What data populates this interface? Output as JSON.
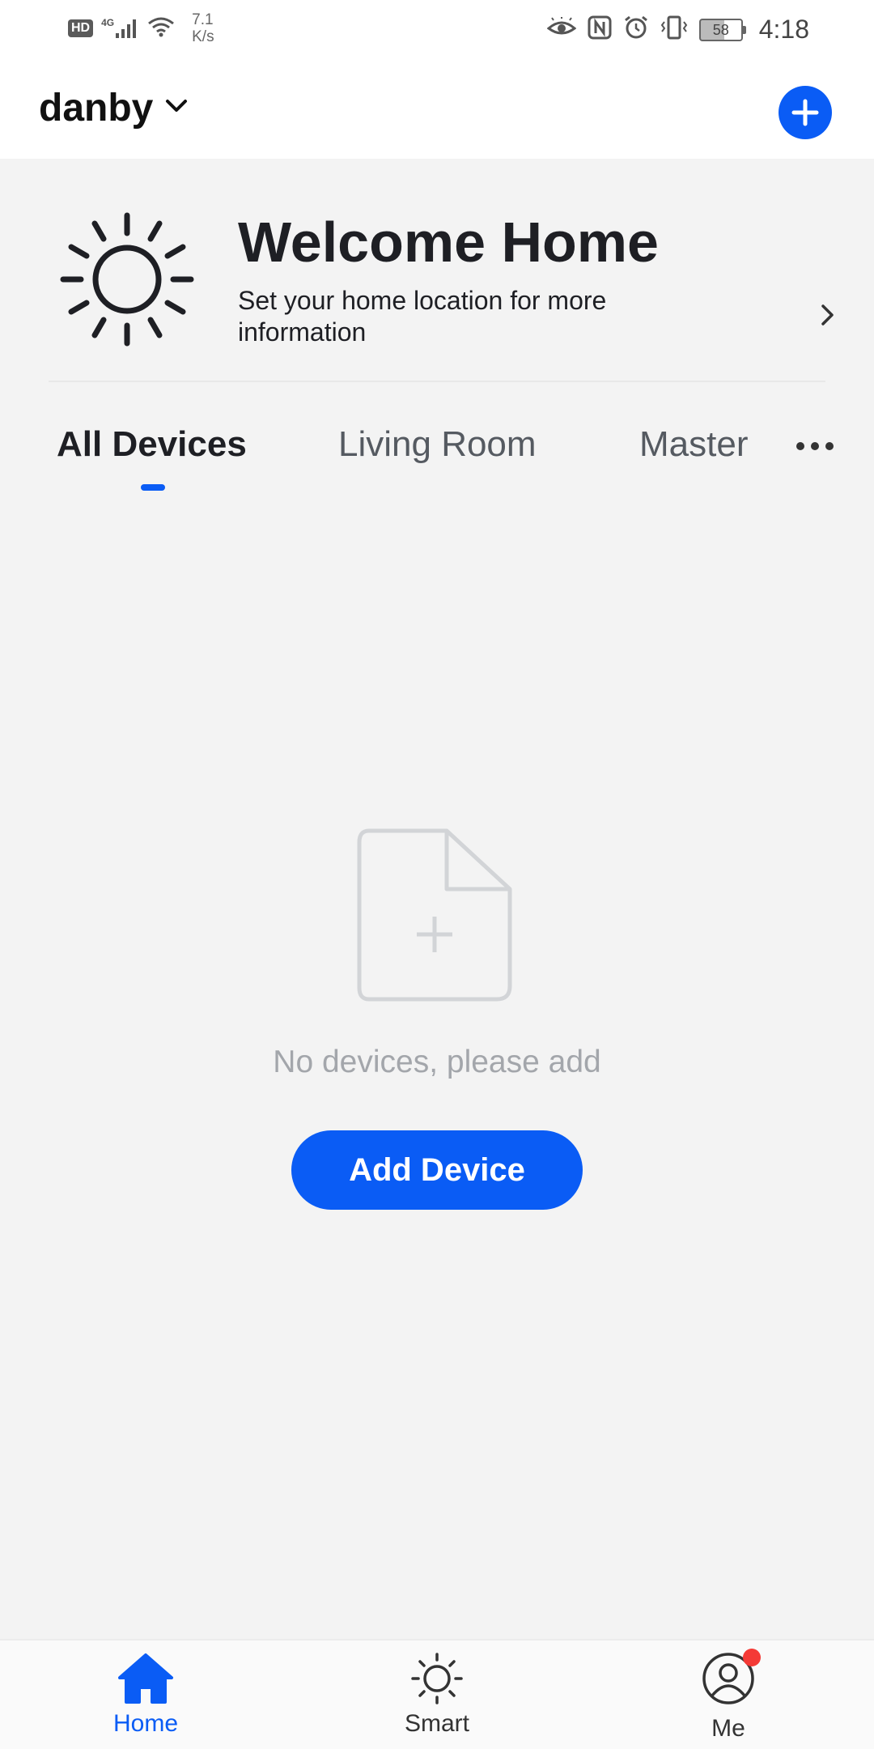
{
  "status_bar": {
    "hd": "HD",
    "network": "4G",
    "speed_value": "7.1",
    "speed_unit": "K/s",
    "battery": "58",
    "time": "4:18"
  },
  "header": {
    "home_name": "danby"
  },
  "welcome": {
    "title": "Welcome Home",
    "subtitle": "Set your home location for more information"
  },
  "tabs": [
    {
      "label": "All Devices",
      "active": true
    },
    {
      "label": "Living Room",
      "active": false
    },
    {
      "label": "Master",
      "active": false
    }
  ],
  "empty_state": {
    "message": "No devices, please add",
    "button_label": "Add Device"
  },
  "bottom_nav": [
    {
      "label": "Home",
      "icon": "home-icon",
      "active": true
    },
    {
      "label": "Smart",
      "icon": "sun-icon",
      "active": false
    },
    {
      "label": "Me",
      "icon": "profile-icon",
      "active": false,
      "badge": true
    }
  ],
  "colors": {
    "accent": "#0a5cf5",
    "background": "#f3f3f3",
    "badge": "#f43a36",
    "muted_text": "#a3a6ab"
  }
}
